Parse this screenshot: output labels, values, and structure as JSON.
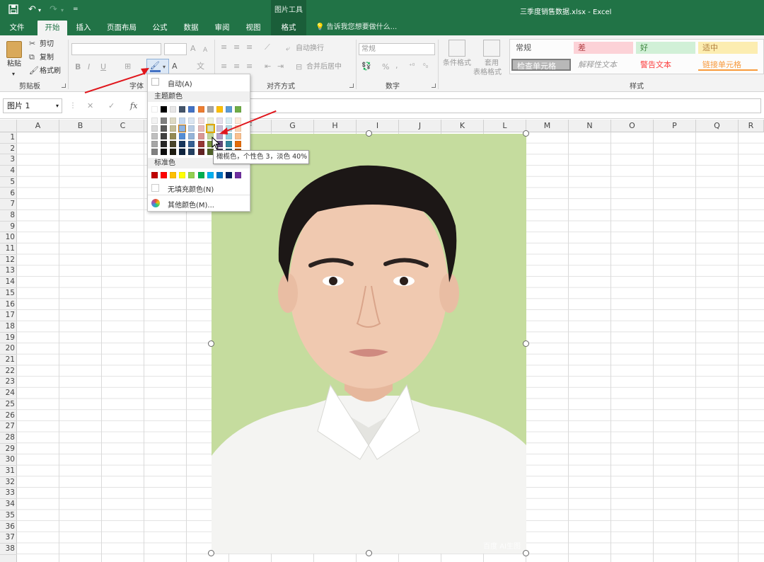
{
  "quick_access": {
    "save_icon": "save-icon",
    "undo_icon": "undo-icon",
    "redo_icon": "redo-icon",
    "customize": "="
  },
  "context_tab_group": "图片工具",
  "window_title": "三季度销售数据.xlsx - Excel",
  "tabs": [
    {
      "label": "文件"
    },
    {
      "label": "开始",
      "active": true
    },
    {
      "label": "插入"
    },
    {
      "label": "页面布局"
    },
    {
      "label": "公式"
    },
    {
      "label": "数据"
    },
    {
      "label": "审阅"
    },
    {
      "label": "视图"
    },
    {
      "label": "格式",
      "contextual": true
    }
  ],
  "tell_me": "告诉我您想要做什么...",
  "ribbon": {
    "clipboard": {
      "paste": "粘贴",
      "cut": "剪切",
      "copy": "复制",
      "format_painter": "格式刷",
      "group": "剪贴板"
    },
    "font": {
      "group": "字体",
      "bold": "B",
      "italic": "I",
      "underline": "U",
      "grow": "A",
      "shrink": "A",
      "font_color": "A"
    },
    "alignment": {
      "wrap_text": "自动换行",
      "merge_center": "合并后居中",
      "group": "对齐方式"
    },
    "number": {
      "format": "常规",
      "percent": "%",
      "comma": ",",
      "group": "数字"
    },
    "styles": {
      "conditional_format": "条件格式",
      "table_format_1": "套用",
      "table_format_2": "表格格式",
      "cells": [
        {
          "label": "常规",
          "bg": "#ffffff",
          "color": "#222222"
        },
        {
          "label": "差",
          "bg": "#ffc7ce",
          "color": "#9c0006"
        },
        {
          "label": "好",
          "bg": "#c6efce",
          "color": "#006100"
        },
        {
          "label": "适中",
          "bg": "#ffeb9c",
          "color": "#9c5700"
        },
        {
          "label": "检查单元格",
          "bg": "#a5a5a5",
          "color": "#ffffff"
        },
        {
          "label": "解释性文本",
          "bg": "#ffffff",
          "color": "#7f7f7f"
        },
        {
          "label": "警告文本",
          "bg": "#ffffff",
          "color": "#ff0000"
        },
        {
          "label": "链接单元格",
          "bg": "#ffffff",
          "color": "#fa7d00"
        }
      ],
      "group": "样式"
    }
  },
  "formula_bar": {
    "name_box": "图片 1",
    "cancel": "✕",
    "enter": "✓",
    "fx": "fx",
    "formula": ""
  },
  "columns": [
    "A",
    "B",
    "C",
    "D",
    "E",
    "F",
    "G",
    "H",
    "I",
    "J",
    "K",
    "L",
    "M",
    "N",
    "O",
    "P",
    "Q",
    "R"
  ],
  "rows": [
    "1",
    "2",
    "3",
    "4",
    "5",
    "6",
    "7",
    "8",
    "9",
    "10",
    "11",
    "12",
    "13",
    "14",
    "15",
    "16",
    "17",
    "18",
    "19",
    "20",
    "21",
    "22",
    "23",
    "24",
    "25",
    "26",
    "27",
    "28",
    "29",
    "30",
    "31",
    "32",
    "33",
    "34",
    "35",
    "36",
    "37",
    "38"
  ],
  "picture": {
    "background": "#c5dc9e",
    "watermark": "百度 AI生图"
  },
  "fill_color_menu": {
    "auto": "自动(A)",
    "theme_header": "主题颜色",
    "standard_header": "标准色",
    "no_fill": "无填充颜色(N)",
    "more_colors": "其他颜色(M)...",
    "theme_base": [
      "#ffffff",
      "#000000",
      "#e7e6e6",
      "#44546a",
      "#4472c4",
      "#ed7d31",
      "#a5a5a5",
      "#ffc000",
      "#5b9bd5",
      "#70ad47"
    ],
    "theme_columns": [
      [
        "#ffffff",
        "#f2f2f2",
        "#d9d9d9",
        "#bfbfbf",
        "#a6a6a6",
        "#808080"
      ],
      [
        "#000000",
        "#7f7f7f",
        "#595959",
        "#404040",
        "#262626",
        "#0d0d0d"
      ],
      [
        "#eeece1",
        "#ddd9c4",
        "#c4bd97",
        "#948a54",
        "#4a452a",
        "#1e1c11"
      ],
      [
        "#1f497d",
        "#c6d9f0",
        "#8db3e2",
        "#548dd4",
        "#17365d",
        "#0f243e"
      ],
      [
        "#4f81bd",
        "#dbe5f1",
        "#b8cce4",
        "#95b3d7",
        "#366092",
        "#244061"
      ],
      [
        "#c0504d",
        "#f2dcdb",
        "#e6b9b8",
        "#d99694",
        "#953734",
        "#632423"
      ],
      [
        "#9bbb59",
        "#ebf1dd",
        "#d7e3bc",
        "#c3d69b",
        "#76923c",
        "#4f6128"
      ],
      [
        "#8064a2",
        "#e5e0ec",
        "#ccc1d9",
        "#b2a2c7",
        "#5f497a",
        "#3f3151"
      ],
      [
        "#4bacc6",
        "#dbeef3",
        "#b7dde8",
        "#92cddc",
        "#31859b",
        "#205867"
      ],
      [
        "#f79646",
        "#fdeada",
        "#fbd5b5",
        "#fac08f",
        "#e36c09",
        "#974806"
      ]
    ],
    "standard": [
      "#c00000",
      "#ff0000",
      "#ffc000",
      "#ffff00",
      "#92d050",
      "#00b050",
      "#00b0f0",
      "#0070c0",
      "#002060",
      "#7030a0"
    ],
    "tooltip": "橄榄色，个性色 3，淡色 40%"
  }
}
